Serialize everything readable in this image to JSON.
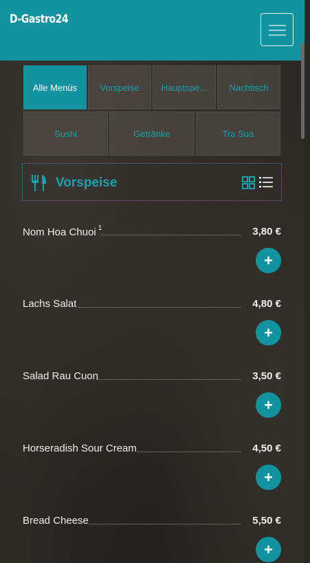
{
  "header": {
    "brand": "D-Gastro24",
    "menu_icon": "hamburger-icon",
    "color": "#13939f"
  },
  "tabs": [
    {
      "label": "Alle Menüs",
      "active": true
    },
    {
      "label": "Vorspeise",
      "active": false
    },
    {
      "label": "Hauptspe...",
      "active": false
    },
    {
      "label": "Nachtisch",
      "active": false
    },
    {
      "label": "Sushi",
      "active": false
    },
    {
      "label": "Getränke",
      "active": false
    },
    {
      "label": "Tra Sua",
      "active": false
    }
  ],
  "section": {
    "title": "Vorspeise",
    "icon": "fork-knife-icon",
    "view_icons": [
      "grid-view-icon",
      "list-view-icon"
    ]
  },
  "items": [
    {
      "name": "Nom Hoa Chuoi",
      "sup": "1",
      "price": "3,80 €"
    },
    {
      "name": "Lachs Salat",
      "sup": "",
      "price": "4,80 €"
    },
    {
      "name": "Salad Rau Cuon",
      "sup": "",
      "price": "3,50 €"
    },
    {
      "name": "Horseradish Sour Cream",
      "sup": "",
      "price": "4,50 €"
    },
    {
      "name": "Bread Cheese",
      "sup": "",
      "price": "5,50 €"
    }
  ],
  "add_label": "+"
}
